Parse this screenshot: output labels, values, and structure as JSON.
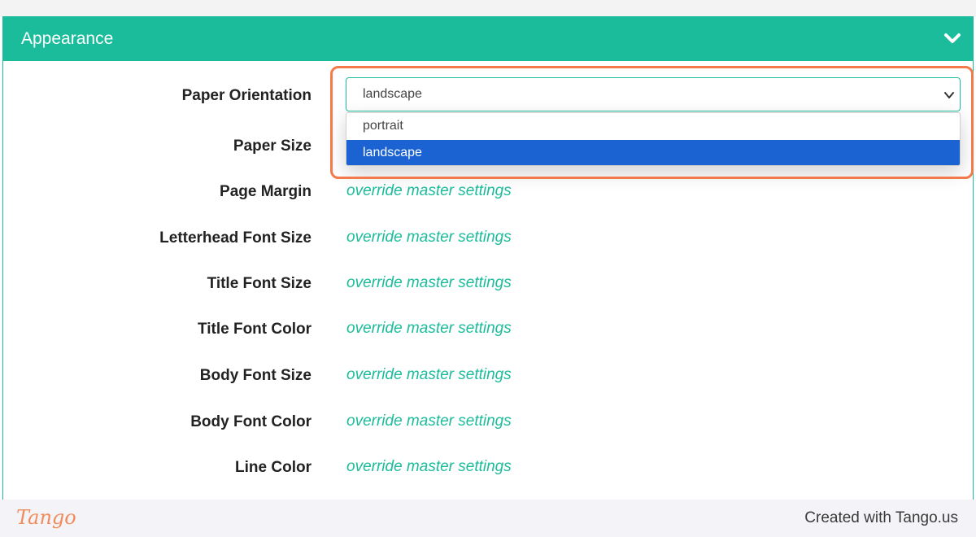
{
  "panel": {
    "title": "Appearance",
    "collapse_icon": "chevron-down-icon",
    "accent_color": "#1bbc9b"
  },
  "paper_orientation": {
    "label": "Paper Orientation",
    "value": "landscape",
    "options": [
      {
        "label": "portrait",
        "selected": false
      },
      {
        "label": "landscape",
        "selected": true
      }
    ]
  },
  "rows": [
    {
      "label": "Paper Size",
      "value": ""
    },
    {
      "label": "Page Margin",
      "value": "override master settings"
    },
    {
      "label": "Letterhead Font Size",
      "value": "override master settings"
    },
    {
      "label": "Title Font Size",
      "value": "override master settings"
    },
    {
      "label": "Title Font Color",
      "value": "override master settings"
    },
    {
      "label": "Body Font Size",
      "value": "override master settings"
    },
    {
      "label": "Body Font Color",
      "value": "override master settings"
    },
    {
      "label": "Line Color",
      "value": "override master settings"
    }
  ],
  "highlight_color": "#f37a4a",
  "footer": {
    "logo": "Tango",
    "credit": "Created with Tango.us"
  }
}
